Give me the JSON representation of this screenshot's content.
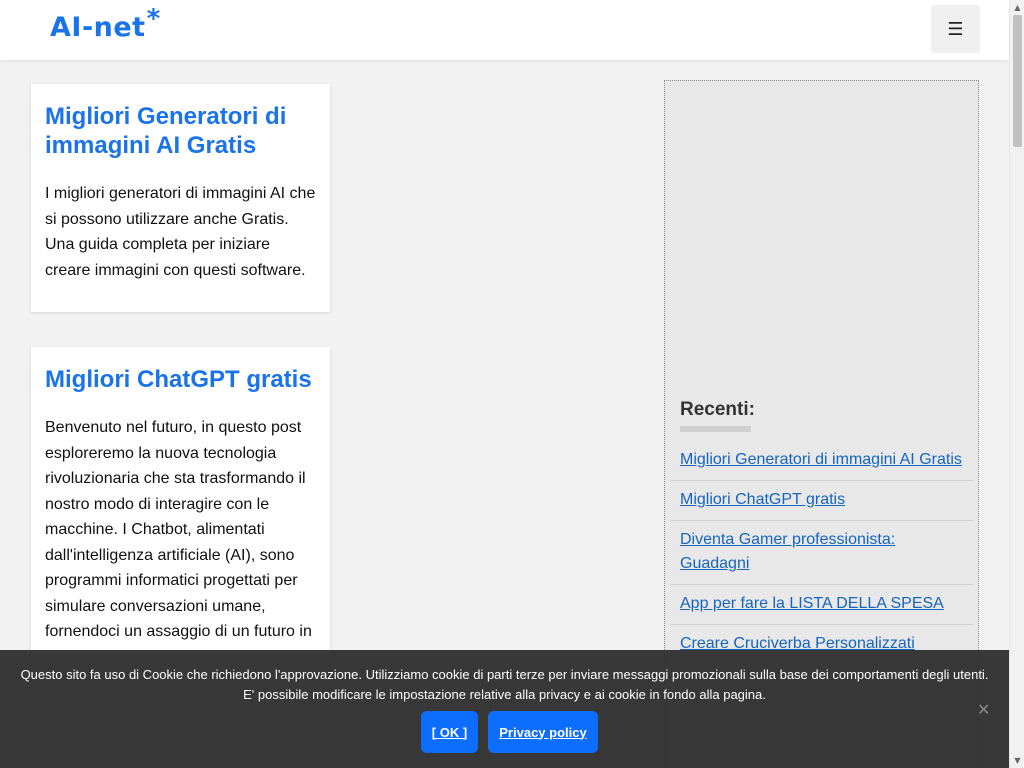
{
  "header": {
    "logo_text": "AI-net",
    "logo_star": "*",
    "menu_icon": "☰"
  },
  "posts": [
    {
      "title": "Migliori Generatori di immagini AI Gratis",
      "excerpt": "I migliori generatori di immagini AI che si possono utilizzare anche Gratis. Una guida completa per iniziare creare immagini con questi software."
    },
    {
      "title": "Migliori ChatGPT gratis",
      "excerpt": "Benvenuto nel futuro, in questo post esploreremo la nuova tecnologia rivoluzionaria che sta trasformando il nostro modo di interagire con le macchine. I Chatbot, alimentati dall'intelligenza artificiale (AI), sono programmi informatici progettati per simulare conversazioni umane, fornendoci un assaggio di un futuro in"
    }
  ],
  "sidebar": {
    "heading": "Recenti:",
    "recent": [
      "Migliori Generatori di immagini AI Gratis",
      "Migliori ChatGPT gratis",
      "Diventa Gamer professionista: Guadagni",
      "App per fare la LISTA DELLA SPESA",
      "Creare Cruciverba Personalizzati"
    ]
  },
  "cookie": {
    "message": "Questo sito fa uso di Cookie che richiedono l'approvazione. Utilizziamo cookie di parti terze per inviare messaggi promozionali sulla base dei comportamenti degli utenti. E' possibile modificare le impostazione relative alla privacy e ai cookie in fondo alla pagina.",
    "ok_label": "[ OK ]",
    "privacy_label": "Privacy policy",
    "close_icon": "✕"
  },
  "colors": {
    "accent": "#1a73e8",
    "link": "#1565c0",
    "button": "#0d6efd",
    "banner": "#323232"
  }
}
